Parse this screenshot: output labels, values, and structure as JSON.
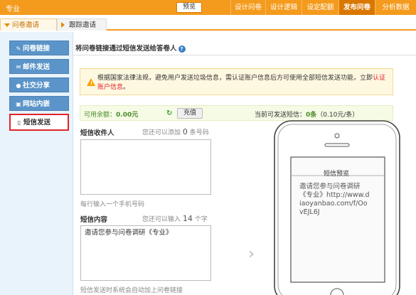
{
  "topbar": {
    "project": "专业",
    "preview": "预览",
    "nav": [
      "设计问卷",
      "设计逻辑",
      "设定配额",
      "发布问卷",
      "分析数据"
    ],
    "active": "发布问卷"
  },
  "tabs": [
    "问卷邀请",
    "跟踪邀请"
  ],
  "sidebar": {
    "items": [
      {
        "label": "问卷链接",
        "icon": "link-icon"
      },
      {
        "label": "邮件发送",
        "icon": "mail-icon"
      },
      {
        "label": "社交分享",
        "icon": "share-icon"
      },
      {
        "label": "网站内嵌",
        "icon": "embed-icon"
      },
      {
        "label": "短信发送",
        "icon": "sms-icon"
      }
    ],
    "active": "短信发送"
  },
  "main": {
    "title": "将问卷链接通过短信发送给答卷人",
    "help": "?",
    "notice_text": "根据国家法律法规，避免用户发送垃圾信息，需认证账户信息后方可使用全部短信发送功能，立即",
    "notice_link": "认证账户信息",
    "notice_end": "。",
    "balance_label": "可用余额：",
    "balance_amount": "0.00元",
    "refresh_icon": "↻",
    "recharge_button": "充值",
    "sms_count_prefix": "当前可发送短信：",
    "sms_count": "0条",
    "sms_price": "（0.10元/条）",
    "recipient_label": "短信收件人",
    "recipient_hint_pre": "您还可以添加",
    "recipient_hint_num": "0",
    "recipient_hint_post": "条号码",
    "recipient_value": "",
    "recipient_tip": "每行输入一个手机号码",
    "content_label": "短信内容",
    "content_hint_pre": "您还可以输入",
    "content_hint_num": "14",
    "content_hint_post": "个字",
    "content_value": "邀请您参与问卷调研《专业》",
    "content_tip": "短信发送时系统会自动加上问卷链接",
    "arrow": "›"
  },
  "phone": {
    "screen_title": "短信预览",
    "screen_message": "邀请您参与问卷调研《专业》http://www.diaoyanbao.com/f/OovEJL6J"
  },
  "colors": {
    "brand_orange": "#f49b1d",
    "sidebar_blue": "#5b94c8",
    "active_red": "#e2232a",
    "balance_green": "#4a8a2b"
  }
}
